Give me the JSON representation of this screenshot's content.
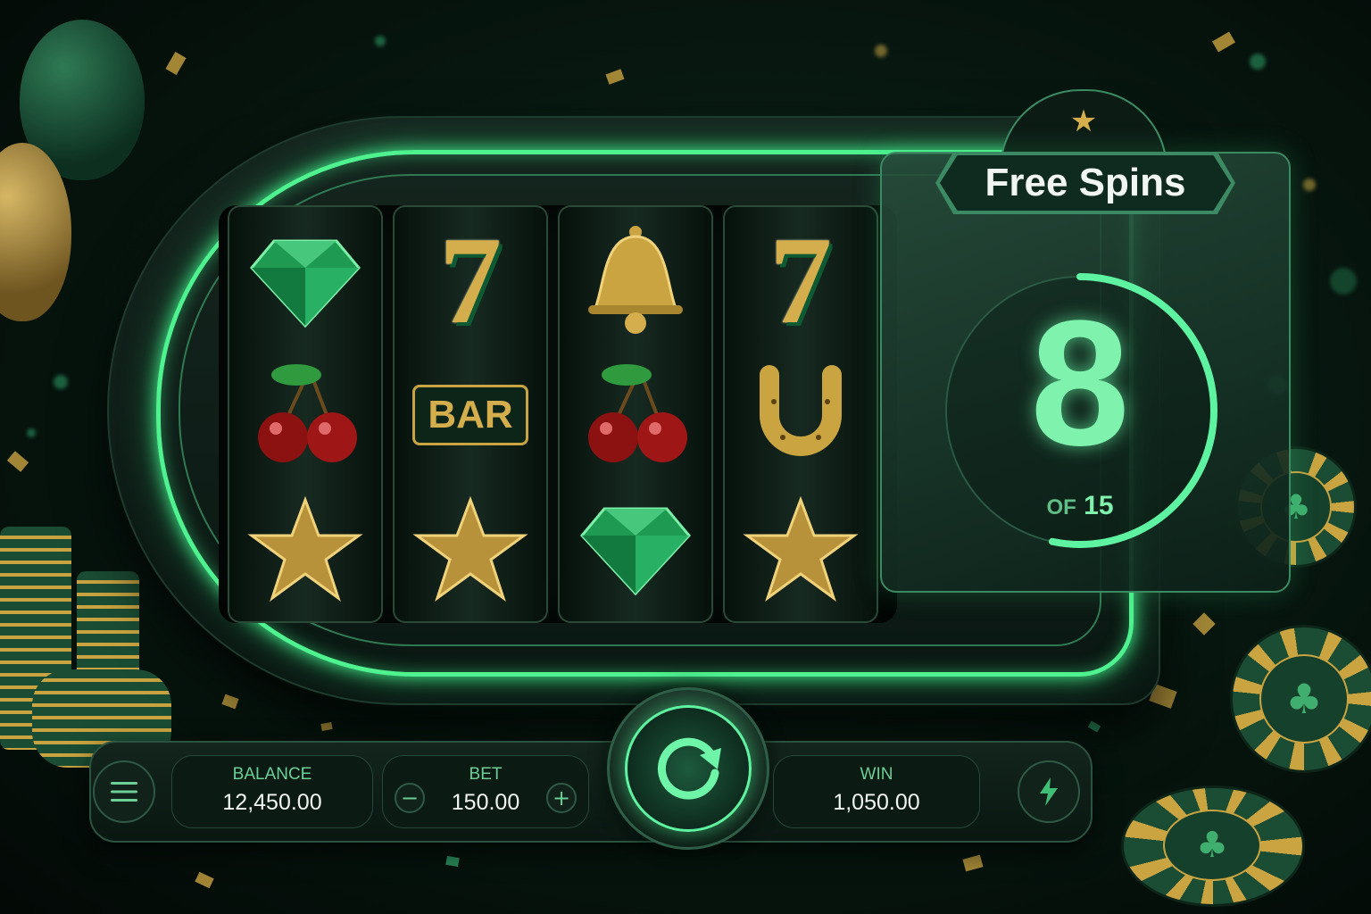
{
  "free_spins": {
    "title": "Free Spins",
    "current": "8",
    "of_label": "OF",
    "total": "15",
    "progress_fraction": 0.533
  },
  "reels": [
    [
      "emerald-gem",
      "cherries",
      "gold-star"
    ],
    [
      "lucky-seven",
      "bar",
      "gold-star"
    ],
    [
      "golden-bell",
      "cherries",
      "emerald-gem"
    ],
    [
      "lucky-seven",
      "horseshoe",
      "gold-star"
    ]
  ],
  "symbol_text": {
    "seven": "7",
    "bar": "BAR"
  },
  "hud": {
    "balance_label": "BALANCE",
    "balance_value": "12,450.00",
    "bet_label": "BET",
    "bet_value": "150.00",
    "bet_minus": "−",
    "bet_plus": "+",
    "win_label": "WIN",
    "win_value": "1,050.00"
  },
  "colors": {
    "neon_green": "#4ef28f",
    "gold": "#c9a441",
    "counter_green": "#7ff3ae"
  },
  "icons": {
    "menu": "hamburger-menu-icon",
    "spin": "refresh-icon",
    "turbo": "lightning-bolt-icon"
  }
}
